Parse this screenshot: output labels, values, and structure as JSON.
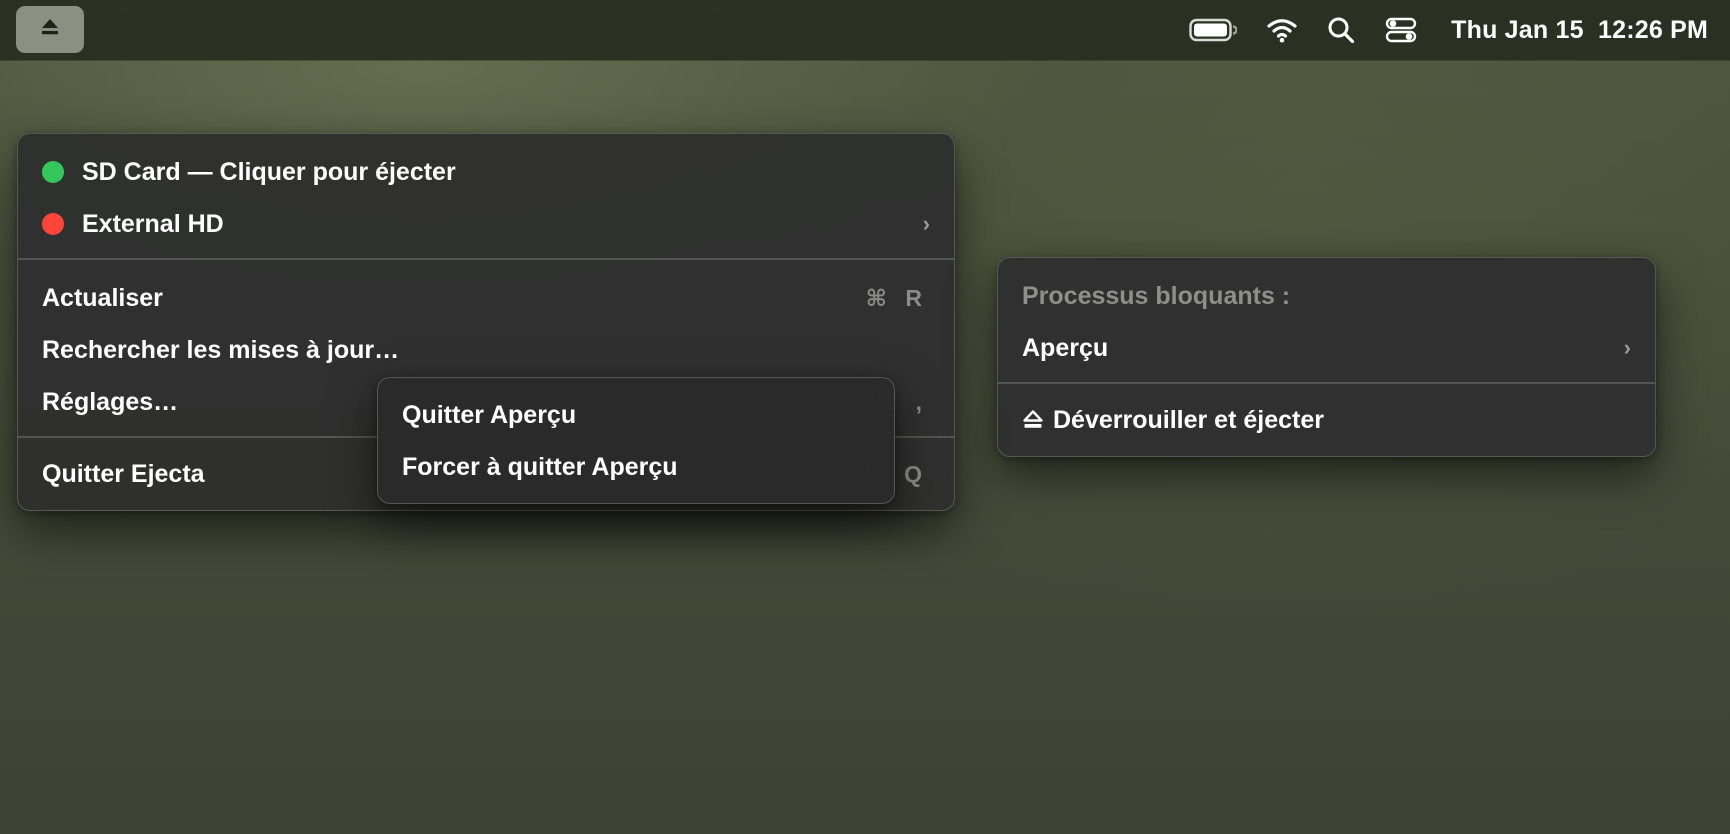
{
  "menubar": {
    "eject_icon": "eject-icon",
    "status_icons": [
      "battery-icon",
      "wifi-icon",
      "search-icon",
      "control-center-icon"
    ],
    "clock": "Thu Jan 15  12:26 PM"
  },
  "main_menu": {
    "drives": [
      {
        "label": "SD Card — Cliquer pour éjecter",
        "status_color": "#34c759",
        "has_submenu": false
      },
      {
        "label": "External HD",
        "status_color": "#ff453a",
        "has_submenu": true,
        "chevron": "›"
      }
    ],
    "actions": [
      {
        "label": "Actualiser",
        "shortcut": "⌘ R"
      },
      {
        "label": "Rechercher les mises à jour…",
        "shortcut": ""
      },
      {
        "label": "Réglages…",
        "shortcut": "⌘ ,"
      }
    ],
    "quit": {
      "label": "Quitter Ejecta",
      "shortcut": "⌘ Q"
    }
  },
  "blocking_menu": {
    "header": "Processus bloquants :",
    "process": {
      "label": "Aperçu",
      "chevron": "›"
    },
    "unlock_eject": {
      "icon": "eject-icon",
      "label": "Déverrouiller et éjecter"
    }
  },
  "process_submenu": {
    "items": [
      {
        "label": "Quitter Aperçu"
      },
      {
        "label": "Forcer à quitter Aperçu"
      }
    ]
  }
}
